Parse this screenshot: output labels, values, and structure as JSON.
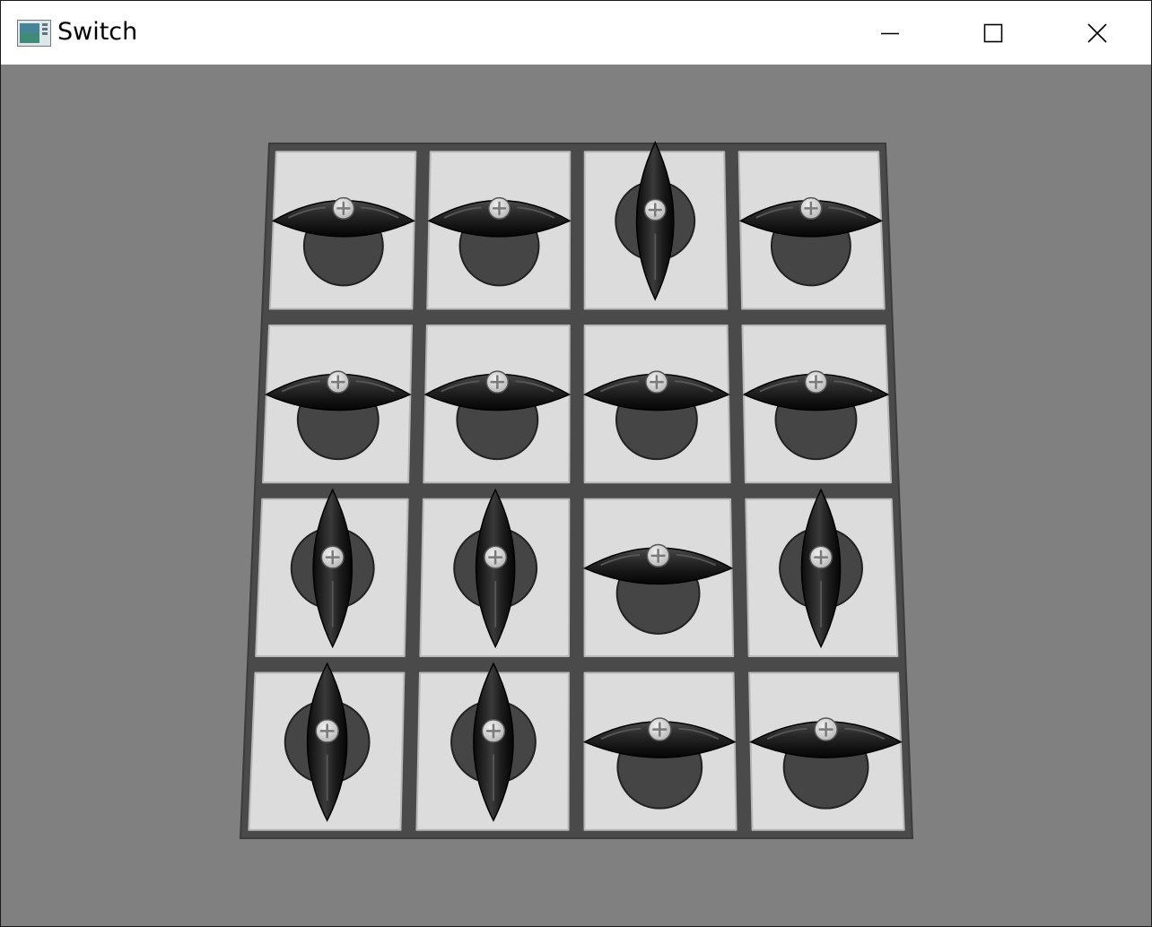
{
  "window": {
    "title": "Switch"
  },
  "titlebar_controls": [
    {
      "name": "minimize-button",
      "icon": "minimize-icon"
    },
    {
      "name": "maximize-button",
      "icon": "maximize-icon"
    },
    {
      "name": "close-button",
      "icon": "close-icon"
    }
  ],
  "game": {
    "rows": 4,
    "cols": 4,
    "orientations": [
      [
        "horizontal",
        "horizontal",
        "vertical",
        "horizontal"
      ],
      [
        "horizontal",
        "horizontal",
        "horizontal",
        "horizontal"
      ],
      [
        "vertical",
        "vertical",
        "horizontal",
        "vertical"
      ],
      [
        "vertical",
        "vertical",
        "horizontal",
        "horizontal"
      ]
    ]
  },
  "colors": {
    "background": "#808080",
    "board_frame": "#4a4a4a",
    "tile": "#dcdcdc",
    "knob": "#1e1e1e",
    "knob_base": "#454545",
    "screw": "#d8d8d8"
  }
}
